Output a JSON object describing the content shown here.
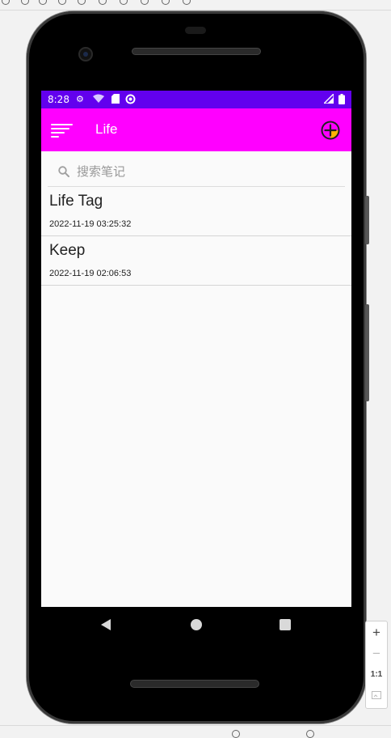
{
  "status_bar": {
    "time": "8:28"
  },
  "app_bar": {
    "title": "Life",
    "menu_icon": "menu-icon",
    "add_icon": "add-circle-icon"
  },
  "search": {
    "placeholder": "搜索笔记",
    "value": ""
  },
  "notes": [
    {
      "title": "Life Tag",
      "time": "2022-11-19 03:25:32"
    },
    {
      "title": "Keep",
      "time": "2022-11-19 02:06:53"
    }
  ],
  "zoom_panel": {
    "zoom_in": "+",
    "zoom_out": "−",
    "actual_size": "1:1"
  },
  "colors": {
    "status_bar": "#6200ee",
    "app_bar": "#ff00ff",
    "add_icon_accent": "#ffb400"
  }
}
